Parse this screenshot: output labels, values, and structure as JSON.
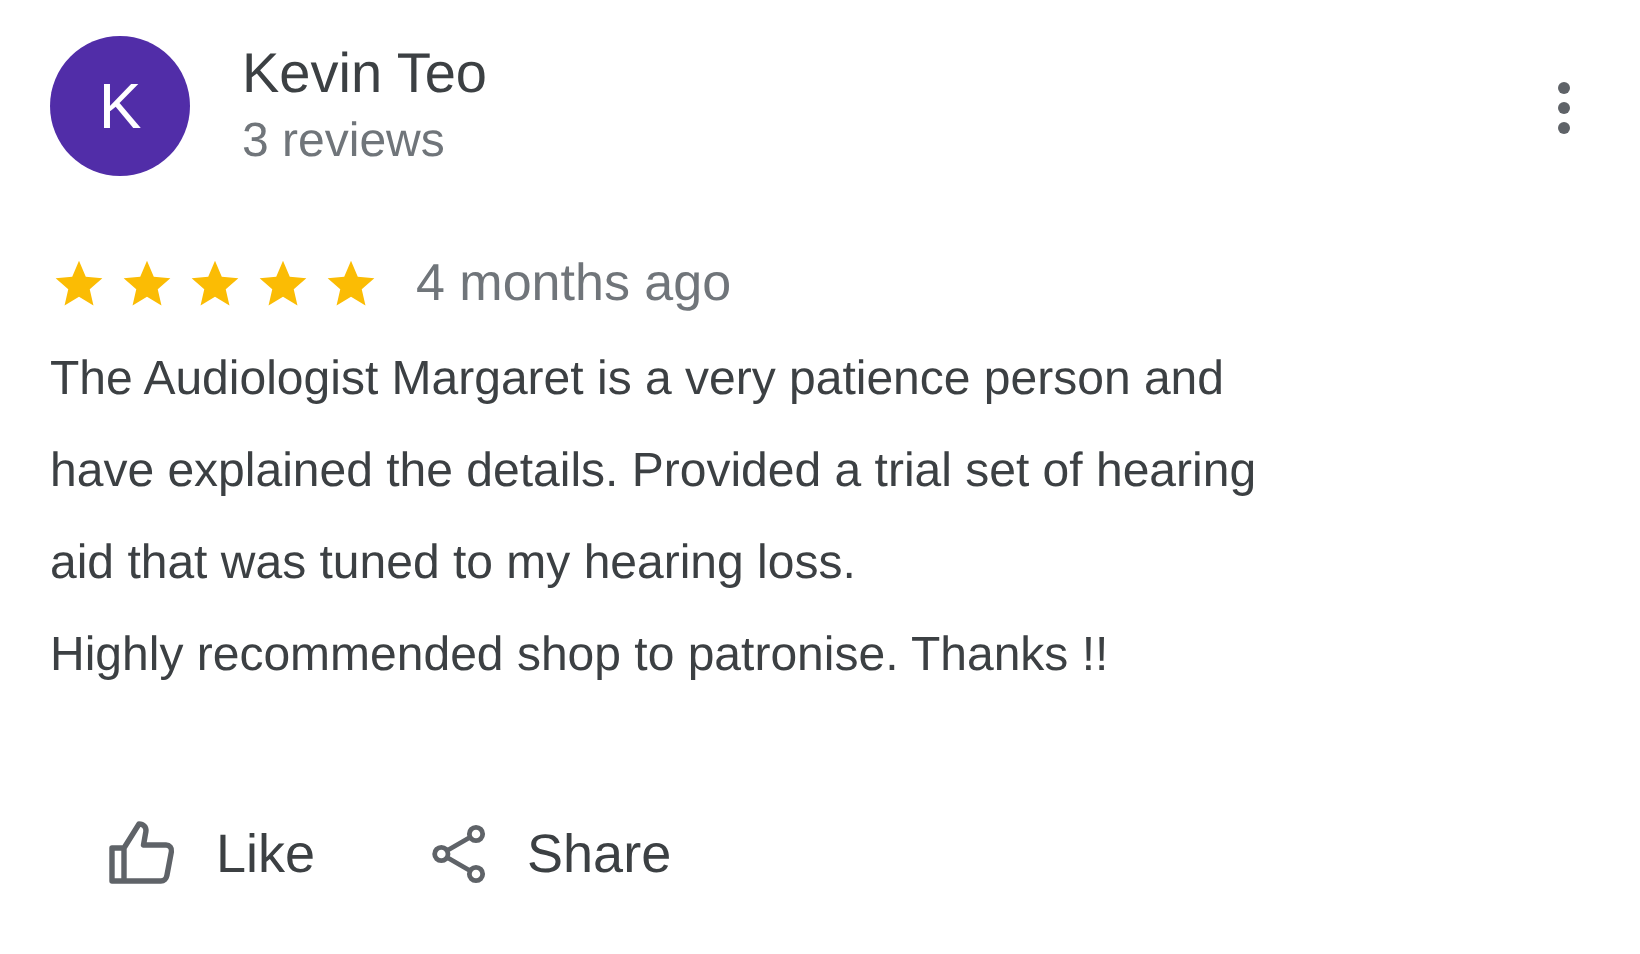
{
  "reviewer": {
    "initial": "K",
    "name": "Kevin Teo",
    "review_count": "3 reviews"
  },
  "review": {
    "stars": 5,
    "time": "4 months ago",
    "text": "The Audiologist Margaret is a very patience person and\nhave explained the details. Provided a trial set of hearing\naid that was tuned to my hearing loss.\nHighly recommended shop to patronise. Thanks !!"
  },
  "actions": [
    {
      "kind": "like",
      "label": "Like"
    },
    {
      "kind": "share",
      "label": "Share"
    }
  ]
}
